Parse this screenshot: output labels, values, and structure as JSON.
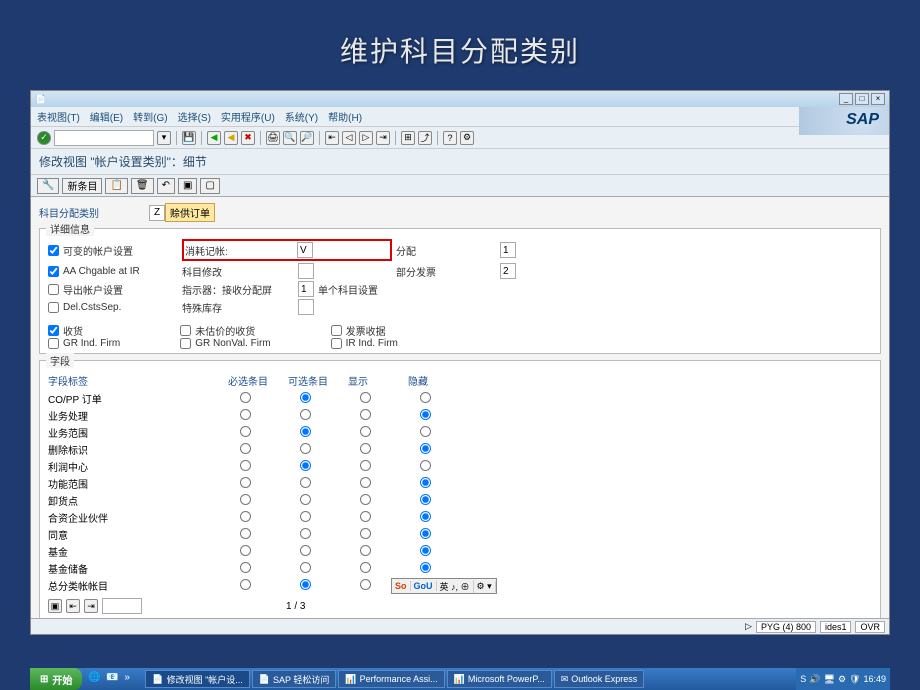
{
  "slide": {
    "title": "维护科目分配类别"
  },
  "menubar": [
    "表视图(T)",
    "编辑(E)",
    "转到(G)",
    "选择(S)",
    "实用程序(U)",
    "系统(Y)",
    "帮助(H)"
  ],
  "page_title": "修改视图 \"帐户设置类别\"：细节",
  "toolbar2": {
    "new_entry": "新条目"
  },
  "category": {
    "label": "科目分配类别",
    "code": "Z",
    "desc": "赊供订单"
  },
  "group_detail": {
    "title": "详细信息",
    "chk_variable": "可变的帐户设置",
    "chk_aa": "AA Chgable at IR",
    "chk_export": "导出帐户设置",
    "chk_del": "Del.CstsSep.",
    "consumption_label": "消耗记帐: ",
    "consumption_value": "V",
    "account_mod": "科目修改",
    "indicator_label": "指示器：接收分配屏",
    "indicator_value": "1",
    "single_account": "单个科目设置",
    "special_stock": "特殊库存",
    "distribution": "分配",
    "distribution_value": "1",
    "partial_invoice": "部分发票",
    "partial_invoice_value": "2"
  },
  "checks": {
    "receipt": "收货",
    "gr_ind_firm": "GR Ind. Firm",
    "unpriced_receipt": "未估价的收货",
    "gr_nonval_firm": "GR NonVal. Firm",
    "invoice_receipt": "发票收据",
    "ir_ind_firm": "IR Ind. Firm"
  },
  "fields": {
    "title": "字段",
    "header_label": "字段标签",
    "header_required": "必选条目",
    "header_optional": "可选条目",
    "header_display": "显示",
    "header_hidden": "隐藏",
    "rows": [
      {
        "name": "CO/PP 订单",
        "sel": 1
      },
      {
        "name": "业务处理",
        "sel": 3
      },
      {
        "name": "业务范围",
        "sel": 1
      },
      {
        "name": "删除标识",
        "sel": 3
      },
      {
        "name": "利润中心",
        "sel": 1
      },
      {
        "name": "功能范围",
        "sel": 3
      },
      {
        "name": "卸货点",
        "sel": 3
      },
      {
        "name": "合资企业伙伴",
        "sel": 3
      },
      {
        "name": "同意",
        "sel": 3
      },
      {
        "name": "基金",
        "sel": 3
      },
      {
        "name": "基金储备",
        "sel": 3
      },
      {
        "name": "总分类帐帐目",
        "sel": 1
      }
    ],
    "page_indicator": "1 / 3"
  },
  "ime": {
    "brand": "So",
    "brand2": "GoU",
    "text": "英 ♪, ⊕"
  },
  "status": {
    "sys": "PYG (4) 800",
    "srv": "ides1",
    "mode": "OVR"
  },
  "taskbar": {
    "start": "开始",
    "items": [
      "修改视图 \"帐户设...",
      "SAP 轻松访问",
      "Performance Assi...",
      "Microsoft PowerP...",
      "Outlook Express"
    ],
    "time": "16:49"
  },
  "sap_logo": "SAP"
}
